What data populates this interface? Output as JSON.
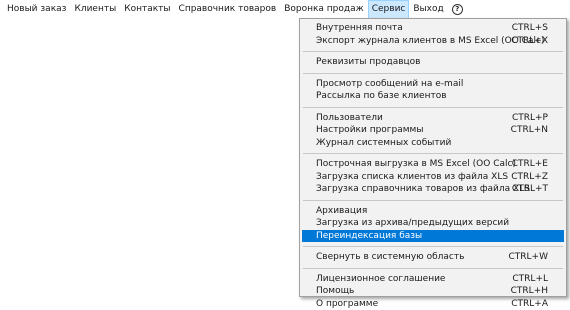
{
  "menubar": {
    "items": [
      "Новый заказ",
      "Клиенты",
      "Контакты",
      "Справочник товаров",
      "Воронка продаж",
      "Сервис",
      "Выход"
    ],
    "active": "Сервис",
    "help_icon": "help-circle-icon"
  },
  "service_menu": {
    "groups": [
      [
        {
          "label": "Внутренняя почта",
          "shortcut": "CTRL+S"
        },
        {
          "label": "Экспорт журнала клиентов в MS Excel (OO Calc)",
          "shortcut": "CTRL+X"
        }
      ],
      [
        {
          "label": "Реквизиты продавцов",
          "shortcut": ""
        }
      ],
      [
        {
          "label": "Просмотр сообщений на e-mail",
          "shortcut": ""
        },
        {
          "label": "Рассылка по базе клиентов",
          "shortcut": ""
        }
      ],
      [
        {
          "label": "Пользователи",
          "shortcut": "CTRL+P"
        },
        {
          "label": "Настройки программы",
          "shortcut": "CTRL+N"
        },
        {
          "label": "Журнал системных событий",
          "shortcut": ""
        }
      ],
      [
        {
          "label": "Построчная выгрузка в MS Excel (OO Calc)",
          "shortcut": "CTRL+E"
        },
        {
          "label": "Загрузка списка клиентов из файла XLS",
          "shortcut": "CTRL+Z"
        },
        {
          "label": "Загрузка справочника товаров из файла XLS",
          "shortcut": "CTRL+T"
        }
      ],
      [
        {
          "label": "Архивация",
          "shortcut": ""
        },
        {
          "label": "Загрузка из архива/предыдущих версий",
          "shortcut": ""
        },
        {
          "label": "Переиндексация базы",
          "shortcut": ""
        }
      ],
      [
        {
          "label": "Свернуть в системную область",
          "shortcut": "CTRL+W"
        }
      ],
      [
        {
          "label": "Лицензионное соглашение",
          "shortcut": "CTRL+L"
        },
        {
          "label": "Помощь",
          "shortcut": "CTRL+H"
        },
        {
          "label": "О программе",
          "shortcut": "CTRL+A"
        }
      ]
    ],
    "highlighted": "Переиндексация базы",
    "highlight_color": "#0078d7"
  }
}
